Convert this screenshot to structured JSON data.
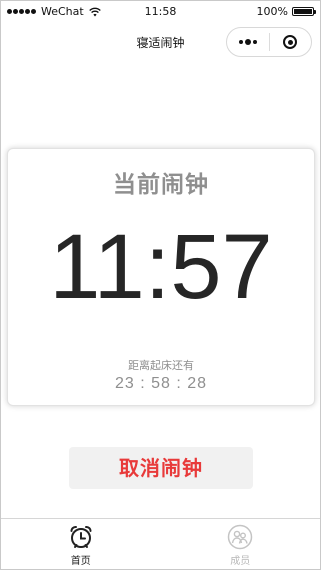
{
  "status_bar": {
    "carrier": "WeChat",
    "time": "11:58",
    "battery": "100%",
    "battery_level": 1.0
  },
  "nav": {
    "title": "寝适闹钟"
  },
  "card": {
    "title": "当前闹钟",
    "alarm_time": "11:57",
    "remaining_label": "距离起床还有",
    "remaining_value": "23 : 58 : 28"
  },
  "cancel_label": "取消闹钟",
  "tabs": [
    {
      "label": "首页",
      "icon": "alarm-clock-icon",
      "active": true
    },
    {
      "label": "成员",
      "icon": "members-icon",
      "active": false
    }
  ],
  "colors": {
    "accent_red": "#e83a3a",
    "muted_gray": "#8f8f8f",
    "time_dark": "#262626",
    "tab_active": "#222222",
    "tab_inactive": "#b8b8b8"
  }
}
